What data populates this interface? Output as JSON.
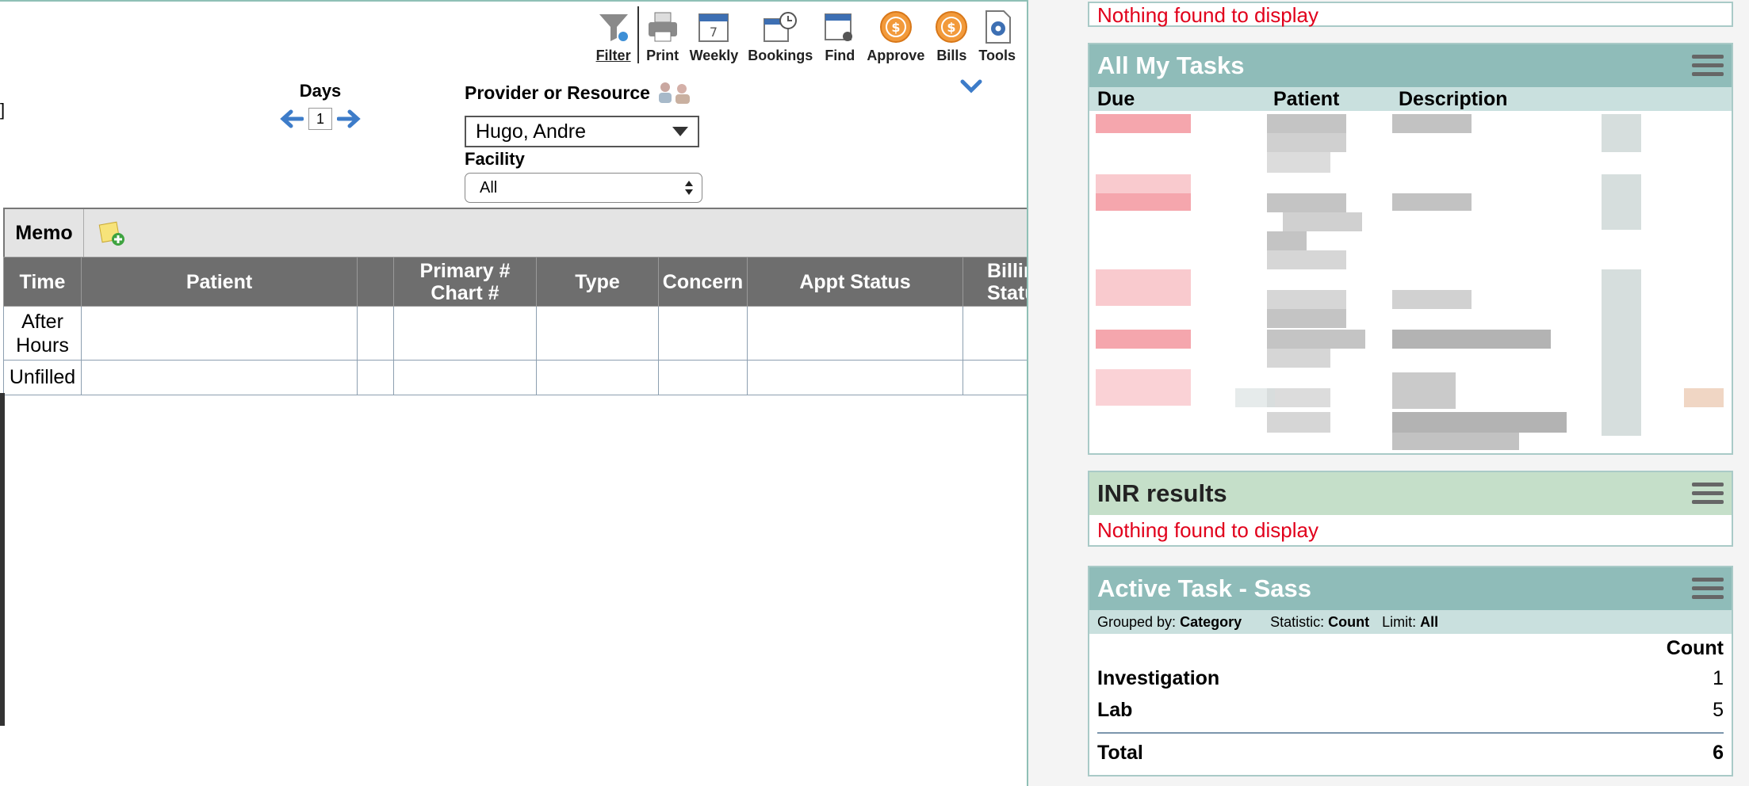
{
  "toolbar": {
    "items": [
      {
        "label": "Filter",
        "icon": "filter-icon"
      },
      {
        "label": "Print",
        "icon": "printer-icon"
      },
      {
        "label": "Weekly",
        "icon": "calendar-week-icon"
      },
      {
        "label": "Bookings",
        "icon": "calendar-clock-icon"
      },
      {
        "label": "Find",
        "icon": "calendar-search-icon"
      },
      {
        "label": "Approve",
        "icon": "approve-coin-icon"
      },
      {
        "label": "Bills",
        "icon": "bills-coin-icon"
      },
      {
        "label": "Tools",
        "icon": "tools-gear-icon"
      }
    ]
  },
  "days": {
    "label": "Days",
    "value": "1"
  },
  "provider": {
    "label": "Provider or Resource",
    "selected": "Hugo, Andre"
  },
  "facility": {
    "label": "Facility",
    "selected": "All"
  },
  "left_marks": {
    "bracket": "]"
  },
  "schedule": {
    "memo_label": "Memo",
    "columns": [
      "Time",
      "Patient",
      "",
      "Primary #\nChart #",
      "Type",
      "Concern",
      "Appt Status",
      "Billing\nStatus"
    ],
    "rows": [
      {
        "time": "After\nHours"
      },
      {
        "time": "Unfilled"
      }
    ]
  },
  "widgets": {
    "top": {
      "message": "Nothing found to display"
    },
    "tasks": {
      "title": "All My Tasks",
      "columns": [
        "Due",
        "Patient",
        "Description"
      ]
    },
    "inr": {
      "title": "INR results",
      "message": "Nothing found to display"
    },
    "active": {
      "title": "Active Task - Sass",
      "grouped_label": "Grouped by:",
      "grouped_value": "Category",
      "statistic_label": "Statistic:",
      "statistic_value": "Count",
      "limit_label": "Limit:",
      "limit_value": "All",
      "count_header": "Count",
      "rows": [
        {
          "name": "Investigation",
          "count": "1"
        },
        {
          "name": "Lab",
          "count": "5"
        }
      ],
      "total_label": "Total",
      "total_value": "6"
    }
  },
  "colors": {
    "accent_teal": "#8fbcb9",
    "inr_green": "#c5dfc9",
    "error_red": "#e1001b",
    "grid_header": "#6e6e6e"
  }
}
